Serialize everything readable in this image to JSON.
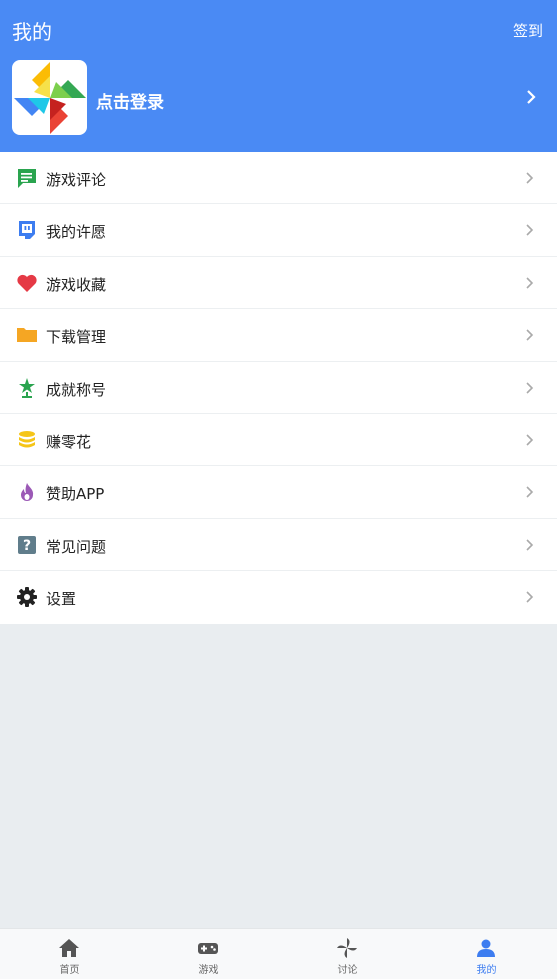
{
  "header": {
    "title": "我的",
    "signin_label": "签到"
  },
  "profile": {
    "login_label": "点击登录"
  },
  "menu": {
    "items": [
      {
        "label": "游戏评论",
        "icon": "comment-icon",
        "color": "#2aa44f"
      },
      {
        "label": "我的许愿",
        "icon": "wish-bubble-icon",
        "color": "#3d7df0"
      },
      {
        "label": "游戏收藏",
        "icon": "heart-icon",
        "color": "#e53945"
      },
      {
        "label": "下载管理",
        "icon": "folder-icon",
        "color": "#f5a623"
      },
      {
        "label": "成就称号",
        "icon": "trophy-star-icon",
        "color": "#2aa44f"
      },
      {
        "label": "赚零花",
        "icon": "coins-icon",
        "color": "#f5c518"
      },
      {
        "label": "赞助APP",
        "icon": "flame-icon",
        "color": "#9b59b6"
      },
      {
        "label": "常见问题",
        "icon": "question-icon",
        "color": "#607d8b"
      },
      {
        "label": "设置",
        "icon": "gear-icon",
        "color": "#222222"
      }
    ]
  },
  "tabs": [
    {
      "label": "首页",
      "icon": "home-icon"
    },
    {
      "label": "游戏",
      "icon": "gamepad-icon"
    },
    {
      "label": "讨论",
      "icon": "pinwheel-icon"
    },
    {
      "label": "我的",
      "icon": "user-icon"
    }
  ],
  "colors": {
    "primary": "#4a8af4",
    "active_tab": "#3d7df0",
    "background": "#e9edf0"
  }
}
